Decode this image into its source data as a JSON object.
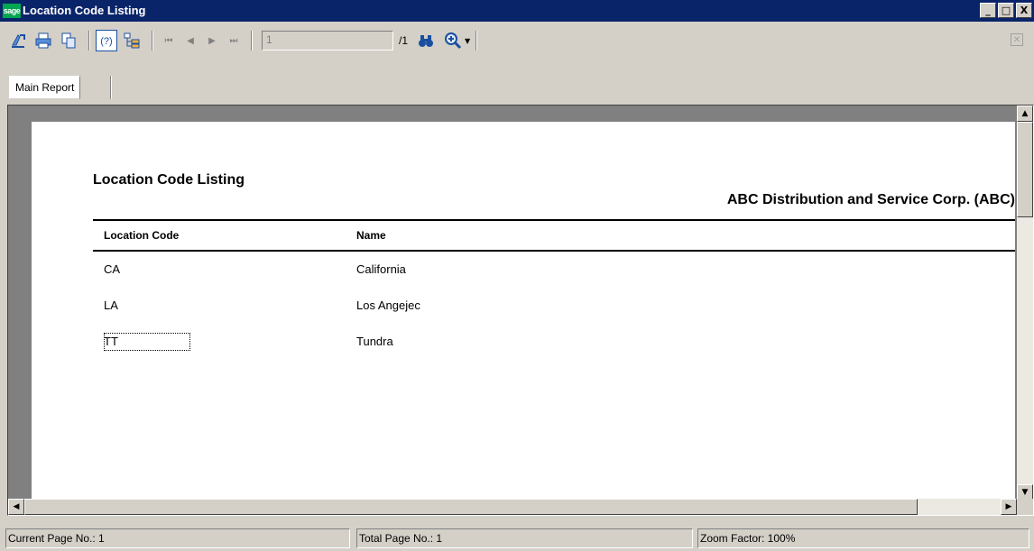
{
  "window": {
    "title": "Location Code Listing",
    "logo_text": "sage",
    "min_label": "_",
    "max_label": "□",
    "close_label": "X"
  },
  "toolbar": {
    "icons": [
      "export-icon",
      "print-icon",
      "copy-icon",
      "help-icon",
      "group-tree-icon"
    ],
    "first_page": "⏮",
    "prev_page": "◀",
    "next_page": "▶",
    "last_page": "⏭",
    "page_input_value": "1",
    "page_total": "/1",
    "search_icon": "binoculars-icon",
    "zoom_icon": "zoom-icon",
    "close_report_label": "✕"
  },
  "tabs": [
    {
      "label": "Main Report"
    }
  ],
  "report": {
    "title": "Location Code Listing",
    "company": "ABC Distribution and Service Corp. (ABC)",
    "columns": {
      "code": "Location Code",
      "name": "Name"
    },
    "rows": [
      {
        "code": "CA",
        "name": "California"
      },
      {
        "code": "LA",
        "name": "Los Angejec"
      },
      {
        "code": "TT",
        "name": "Tundra"
      }
    ]
  },
  "status": {
    "current_page": "Current Page No.: 1",
    "total_page": "Total Page No.: 1",
    "zoom": "Zoom Factor: 100%"
  }
}
